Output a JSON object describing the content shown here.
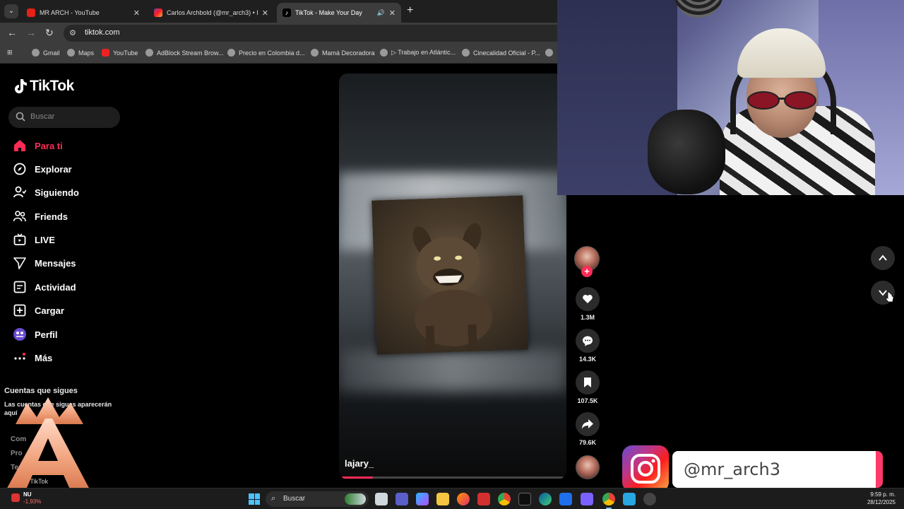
{
  "browser": {
    "tabs": [
      {
        "title": "MR ARCH - YouTube",
        "active": false
      },
      {
        "title": "Carlos Archbold (@mr_arch3) • Fo",
        "active": false
      },
      {
        "title": "TikTok - Make Your Day",
        "active": true
      }
    ],
    "url": "tiktok.com",
    "bookmarks": [
      "Gmail",
      "Maps",
      "YouTube",
      "AdBlock Stream Brow...",
      "Precio en Colombia d...",
      "Mamá Decoradora",
      "▷ Trabajo en Atlántic...",
      "Cinecalidad Oficial - P..."
    ]
  },
  "tiktok": {
    "logo_text": "TikTok",
    "search_placeholder": "Buscar",
    "nav": [
      {
        "label": "Para ti",
        "icon": "home-icon",
        "active": true
      },
      {
        "label": "Explorar",
        "icon": "compass-icon"
      },
      {
        "label": "Siguiendo",
        "icon": "following-icon"
      },
      {
        "label": "Friends",
        "icon": "friends-icon"
      },
      {
        "label": "LIVE",
        "icon": "live-icon"
      },
      {
        "label": "Mensajes",
        "icon": "messages-icon"
      },
      {
        "label": "Actividad",
        "icon": "activity-icon"
      },
      {
        "label": "Cargar",
        "icon": "upload-icon"
      },
      {
        "label": "Perfil",
        "icon": "profile-icon"
      },
      {
        "label": "Más",
        "icon": "more-icon"
      }
    ],
    "following_title": "Cuentas que sigues",
    "following_desc": "Las cuentas que sigues aparecerán aquí",
    "footer_links": [
      "Com",
      "Pro",
      "Te"
    ],
    "footer_copy": "25 TikTok",
    "video": {
      "username": "lajary_",
      "progress": 0.14
    },
    "actions": {
      "likes": "1.3M",
      "comments": "14.3K",
      "saves": "107.5K",
      "shares": "79.6K"
    }
  },
  "overlay": {
    "instagram_handle": "@mr_arch3"
  },
  "taskbar": {
    "stock_name": "NU",
    "stock_change": "-1,93%",
    "search_placeholder": "Buscar",
    "time": "9:59 p. m.",
    "date": "28/12/2025"
  },
  "colors": {
    "accent": "#fe2c55",
    "background": "#000000"
  }
}
